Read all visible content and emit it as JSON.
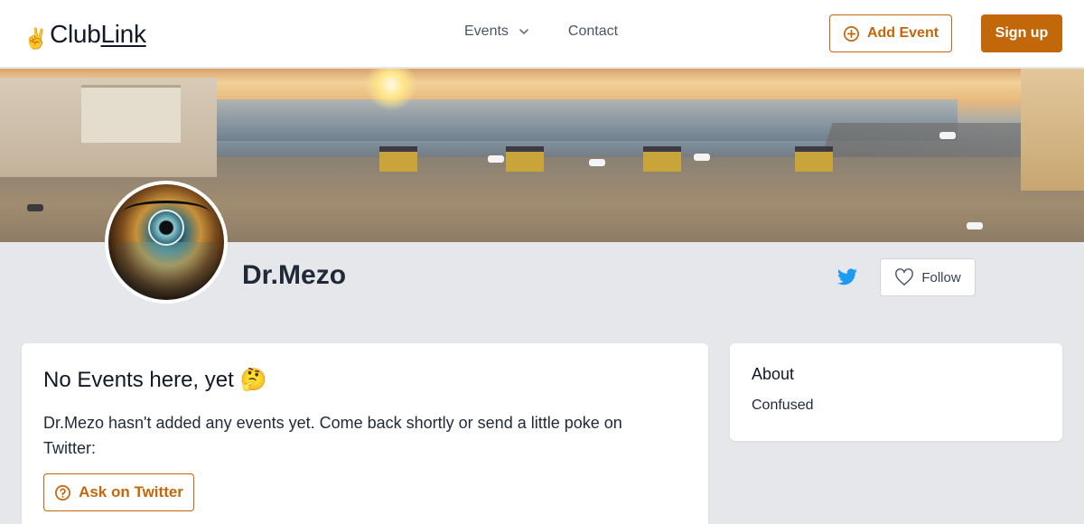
{
  "header": {
    "logo_prefix": "Club",
    "logo_suffix": "Link",
    "logo_emoji": "✌️",
    "nav": [
      {
        "label": "Events",
        "has_dropdown": true
      },
      {
        "label": "Contact",
        "has_dropdown": false
      }
    ],
    "add_event_label": "Add Event",
    "signup_label": "Sign up"
  },
  "profile": {
    "name": "Dr.Mezo",
    "follow_label": "Follow",
    "twitter_icon": "twitter-icon"
  },
  "events_card": {
    "title": "No Events here, yet 🤔",
    "body": "Dr.Mezo hasn't added any events yet. Come back shortly or send a little poke on Twitter:",
    "ask_label": "Ask on Twitter"
  },
  "about_card": {
    "heading": "About",
    "value": "Confused"
  },
  "colors": {
    "accent": "#c2670a",
    "page_bg": "#e5e7eb",
    "twitter": "#1d9bf0"
  }
}
